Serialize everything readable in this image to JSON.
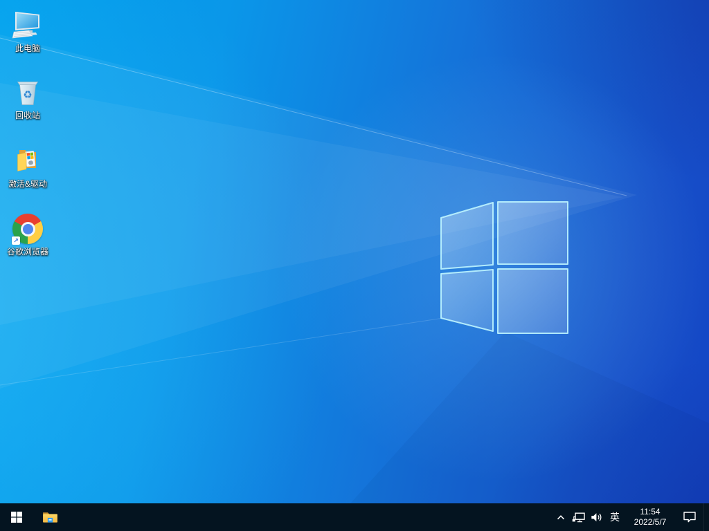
{
  "wallpaper": {
    "style": "windows10-light-rays",
    "accent_left": "#00a2ee",
    "accent_right": "#1546c8",
    "logo": "windows-glass-logo"
  },
  "desktop": {
    "icons": [
      {
        "id": "this-pc",
        "label": "此电脑",
        "icon": "monitor-keyboard-icon"
      },
      {
        "id": "recycle-bin",
        "label": "回收站",
        "icon": "recycle-bin-icon"
      },
      {
        "id": "activation-drivers",
        "label": "激活&驱动",
        "icon": "open-folder-windows-icon"
      },
      {
        "id": "google-chrome",
        "label": "谷歌浏览器",
        "icon": "chrome-icon",
        "overlay": "shortcut-arrow"
      }
    ]
  },
  "taskbar": {
    "background": "#041420",
    "pinned": [
      {
        "id": "start",
        "icon": "windows-start-icon"
      },
      {
        "id": "file-explorer",
        "icon": "file-explorer-icon"
      }
    ],
    "tray": {
      "hidden_icons": "chevron-up-icon",
      "network": "ethernet-icon",
      "volume": "speaker-icon",
      "language_indicator": "英",
      "clock_time": "11:54",
      "clock_date": "2022/5/7",
      "notifications": "action-center-icon"
    }
  }
}
